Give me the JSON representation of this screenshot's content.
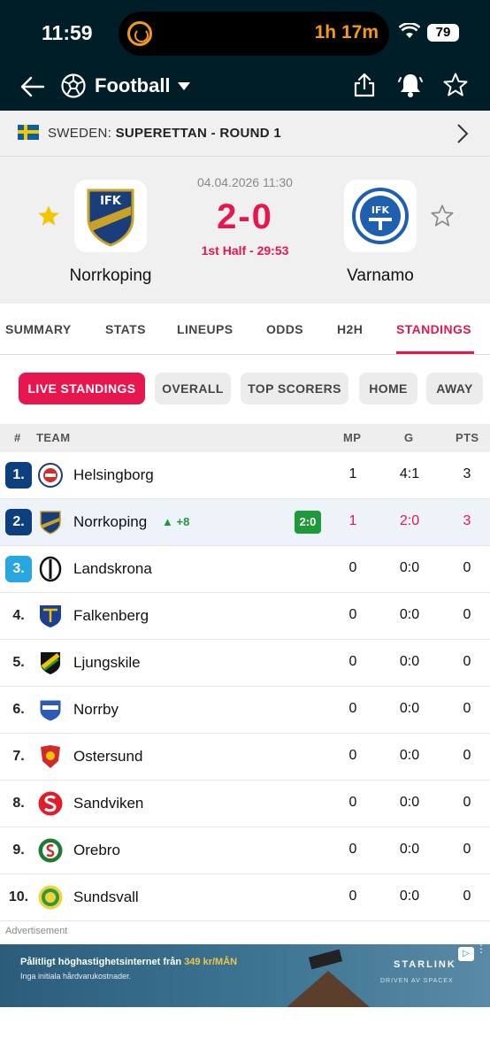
{
  "status_bar": {
    "time": "11:59",
    "timer": "1h 17m",
    "battery": "79"
  },
  "header": {
    "title": "Football"
  },
  "league": {
    "country": "SWEDEN:",
    "competition": "SUPERETTAN - ROUND 1"
  },
  "match": {
    "date": "04.04.2026 11:30",
    "score": "2-0",
    "phase": "1st Half - 29:53",
    "home": {
      "name": "Norrkoping",
      "crest_text": "IFK"
    },
    "away": {
      "name": "Varnamo",
      "crest_text": "IFK"
    }
  },
  "tabs": [
    "SUMMARY",
    "STATS",
    "LINEUPS",
    "ODDS",
    "H2H",
    "STANDINGS"
  ],
  "active_tab": "STANDINGS",
  "chips": [
    "LIVE STANDINGS",
    "OVERALL",
    "TOP SCORERS",
    "HOME",
    "AWAY"
  ],
  "table": {
    "headers": {
      "rank": "#",
      "team": "TEAM",
      "mp": "MP",
      "g": "G",
      "pts": "PTS"
    },
    "rows": [
      {
        "rank": "1.",
        "team": "Helsingborg",
        "mp": "1",
        "g": "4:1",
        "pts": "3",
        "crest_color": "#d52b2b"
      },
      {
        "rank": "2.",
        "team": "Norrkoping",
        "mp": "1",
        "g": "2:0",
        "pts": "3",
        "trend": "+8",
        "live": "2:0",
        "crest_color": "#1a3d7c"
      },
      {
        "rank": "3.",
        "team": "Landskrona",
        "mp": "0",
        "g": "0:0",
        "pts": "0",
        "crest_color": "#111111"
      },
      {
        "rank": "4.",
        "team": "Falkenberg",
        "mp": "0",
        "g": "0:0",
        "pts": "0",
        "crest_color": "#1c3f94"
      },
      {
        "rank": "5.",
        "team": "Ljungskile",
        "mp": "0",
        "g": "0:0",
        "pts": "0",
        "crest_color": "#1e9a3d"
      },
      {
        "rank": "6.",
        "team": "Norrby",
        "mp": "0",
        "g": "0:0",
        "pts": "0",
        "crest_color": "#2a5bb5"
      },
      {
        "rank": "7.",
        "team": "Ostersund",
        "mp": "0",
        "g": "0:0",
        "pts": "0",
        "crest_color": "#d12a2a"
      },
      {
        "rank": "8.",
        "team": "Sandviken",
        "mp": "0",
        "g": "0:0",
        "pts": "0",
        "crest_color": "#e01d2a"
      },
      {
        "rank": "9.",
        "team": "Orebro",
        "mp": "0",
        "g": "0:0",
        "pts": "0",
        "crest_color": "#1f7a35"
      },
      {
        "rank": "10.",
        "team": "Sundsvall",
        "mp": "0",
        "g": "0:0",
        "pts": "0",
        "crest_color": "#2f9a3d"
      }
    ]
  },
  "ad": {
    "label": "Advertisement",
    "line1": "Pålitligt höghastighetsinternet från",
    "price": "349 kr/MÅN",
    "line2": "Inga initiala hårdvarukostnader.",
    "brand": "STARLINK",
    "sub": "DRIVEN AV SPACEX"
  },
  "colors": {
    "accent": "#e8164e",
    "header_bg": "#001e28",
    "live_green": "#1f9a3a"
  }
}
